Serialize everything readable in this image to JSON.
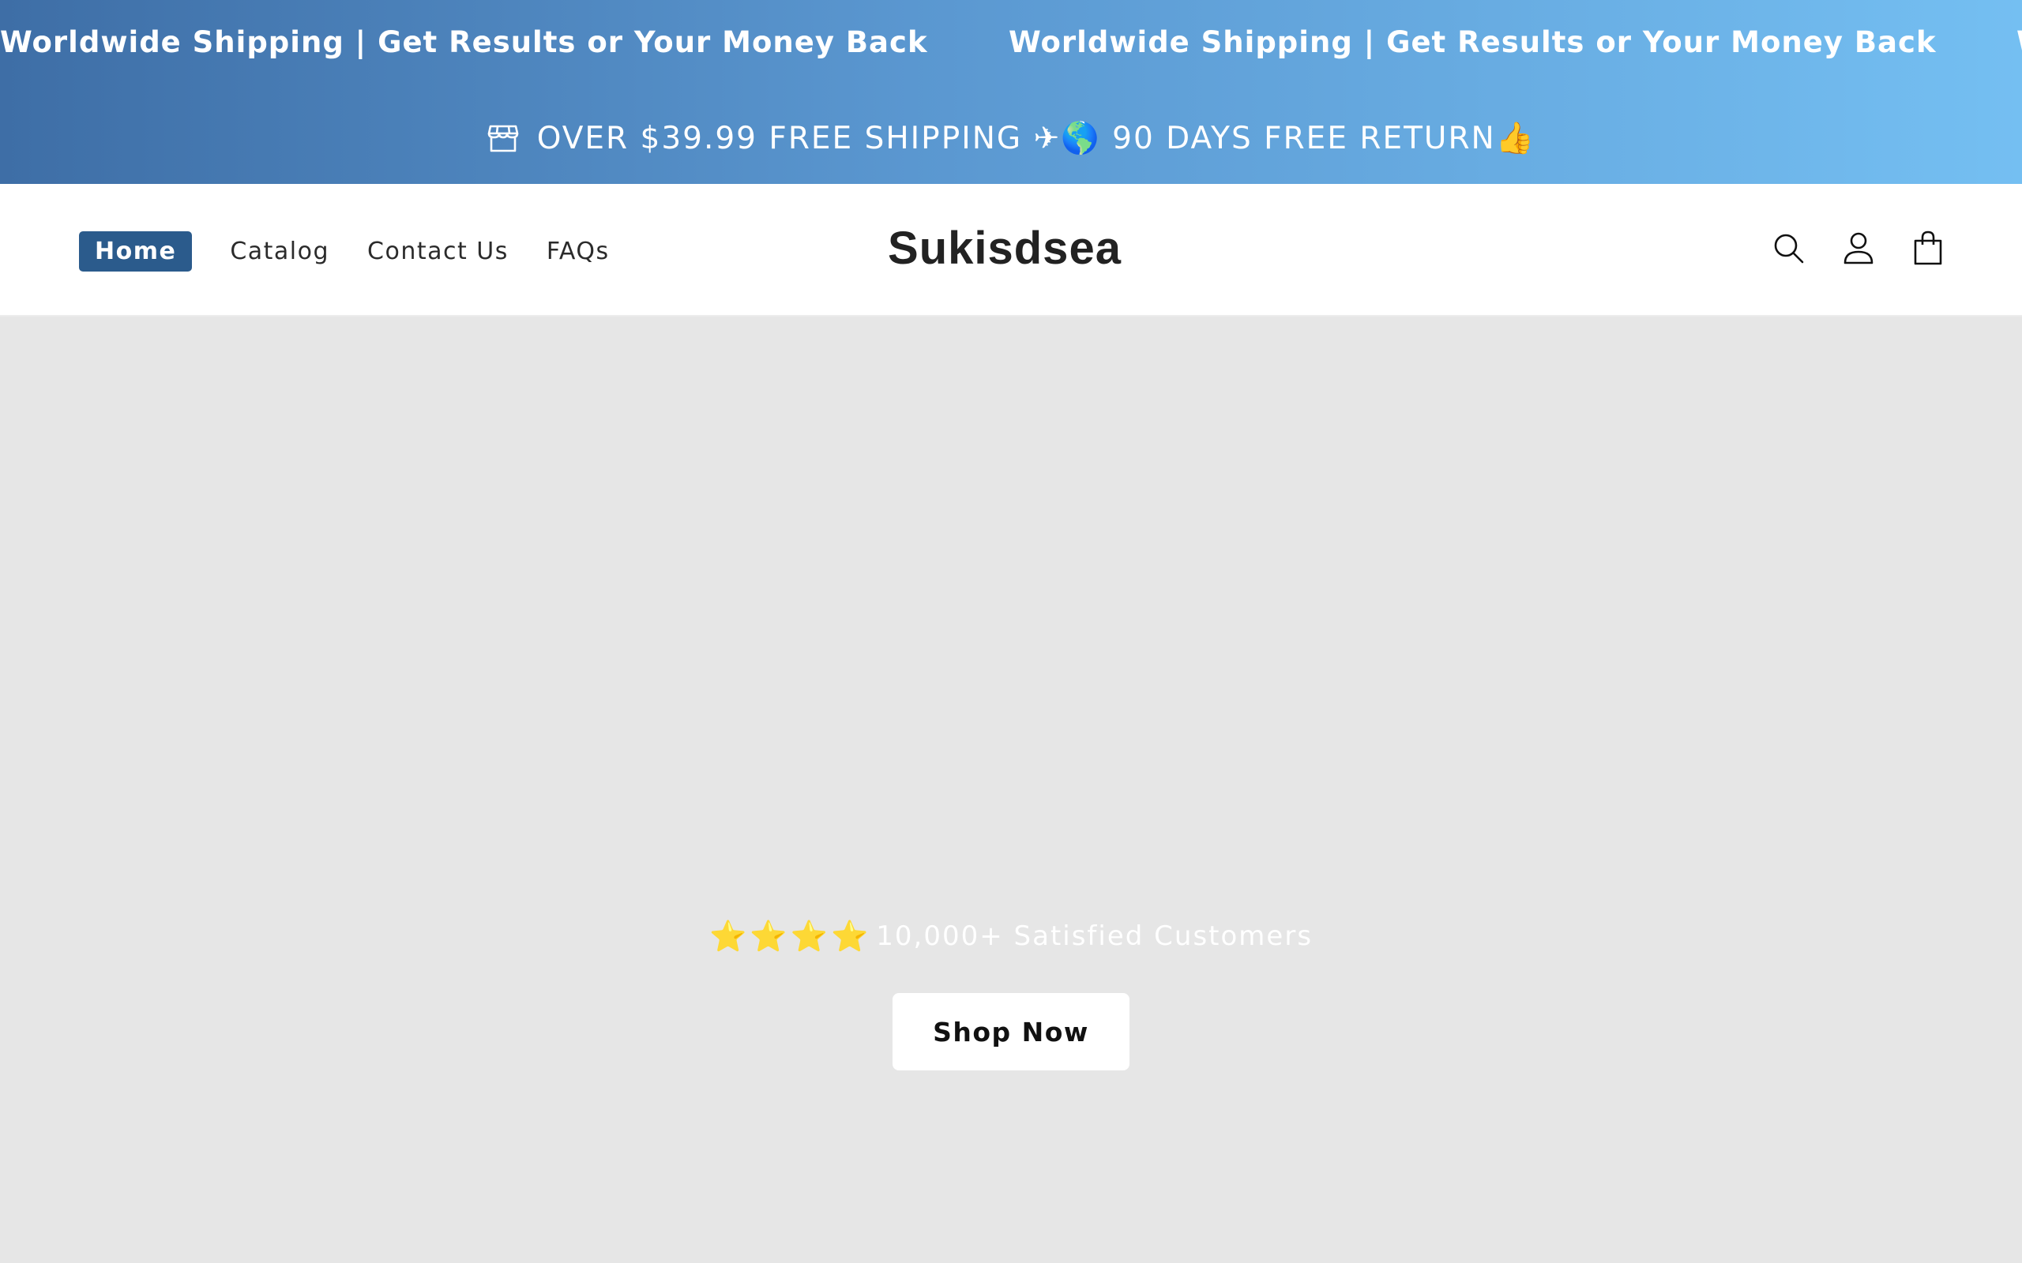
{
  "marquee": {
    "items": [
      "Worldwide Shipping | Get Results or Your Money Back",
      "Worldwide Shipping | Get Results or Your Money Back",
      "W"
    ]
  },
  "announcement": {
    "icon": "store-icon",
    "text": "OVER $39.99 FREE SHIPPING ✈🌎 90 DAYS FREE RETURN👍"
  },
  "header": {
    "nav": [
      {
        "label": "Home",
        "active": true
      },
      {
        "label": "Catalog",
        "active": false
      },
      {
        "label": "Contact Us",
        "active": false
      },
      {
        "label": "FAQs",
        "active": false
      }
    ],
    "brand": "Sukisdsea",
    "icons": [
      "search-icon",
      "account-icon",
      "cart-icon"
    ]
  },
  "hero": {
    "stars": [
      "⭐",
      "⭐",
      "⭐",
      "⭐"
    ],
    "rating_text": "10,000+ Satisfied Customers",
    "cta_label": "Shop Now"
  },
  "colors": {
    "banner_gradient_start": "#3e6ea6",
    "banner_gradient_end": "#74bff2",
    "active_nav_bg": "#2b5b8c",
    "hero_bg": "#e6e6e6",
    "star": "#f4c430"
  }
}
